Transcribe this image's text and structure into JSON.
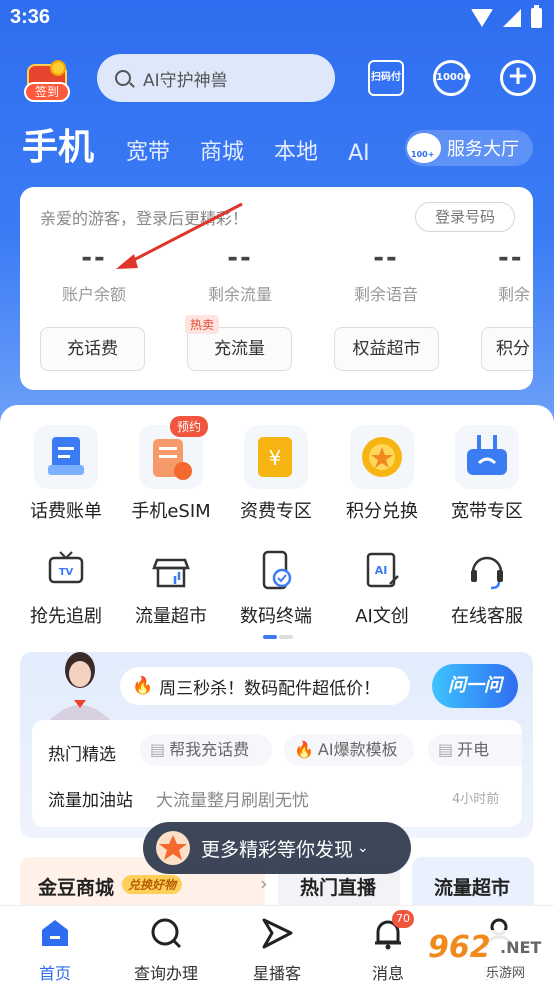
{
  "status_bar": {
    "time": "3:36"
  },
  "header": {
    "signin_label": "签到",
    "search_placeholder": "AI守护神兽",
    "scan_label": "扫码付",
    "hotline_label": "10000"
  },
  "tabs": [
    "手机",
    "宽带",
    "商城",
    "本地",
    "AI"
  ],
  "service_hall": {
    "label": "服务大厅",
    "badge": "100+"
  },
  "account": {
    "greeting": "亲爱的游客，登录后更精彩！",
    "login_label": "登录号码",
    "stats": [
      {
        "value": "--",
        "label": "账户余额"
      },
      {
        "value": "--",
        "label": "剩余流量"
      },
      {
        "value": "--",
        "label": "剩余语音"
      },
      {
        "value": "--",
        "label": "剩余"
      }
    ],
    "actions": [
      "充话费",
      "充流量",
      "权益超市",
      "积分"
    ],
    "hot_tag": "热卖"
  },
  "grid": {
    "row1": [
      "话费账单",
      "手机eSIM",
      "资费专区",
      "积分兑换",
      "宽带专区"
    ],
    "row2": [
      "抢先追剧",
      "流量超市",
      "数码终端",
      "AI文创",
      "在线客服"
    ],
    "preorder_badge": "预约",
    "icons_row1": [
      "bill-icon",
      "esim-icon",
      "tariff-icon",
      "points-icon",
      "broadband-icon"
    ],
    "icons_row2": [
      "tv-icon",
      "traffic-store-icon",
      "device-icon",
      "ai-creative-icon",
      "headset-icon"
    ]
  },
  "promo": {
    "banner": "周三秒杀！数码配件超低价！",
    "ask_label": "问一问",
    "row1_title": "热门精选",
    "chips": [
      "帮我充话费",
      "AI爆款模板",
      "开电"
    ],
    "row2_title": "流量加油站",
    "row2_desc": "大流量整月刷剧无忧",
    "row2_time": "4小时前"
  },
  "toast": {
    "label": "更多精彩等你发现"
  },
  "tiles": {
    "t1": "金豆商城",
    "t1_tag": "兑换好物",
    "t2": "热门直播",
    "t3": "流量超市"
  },
  "bottom_nav": [
    "首页",
    "查询办理",
    "星播客",
    "消息",
    "我的"
  ],
  "message_badge": "70",
  "watermark": {
    "num": "962",
    "net": ".NET",
    "sub": "乐游网"
  },
  "colors": {
    "primary": "#2f6df0",
    "accent_red": "#f2553d",
    "orange": "#f5682e"
  }
}
